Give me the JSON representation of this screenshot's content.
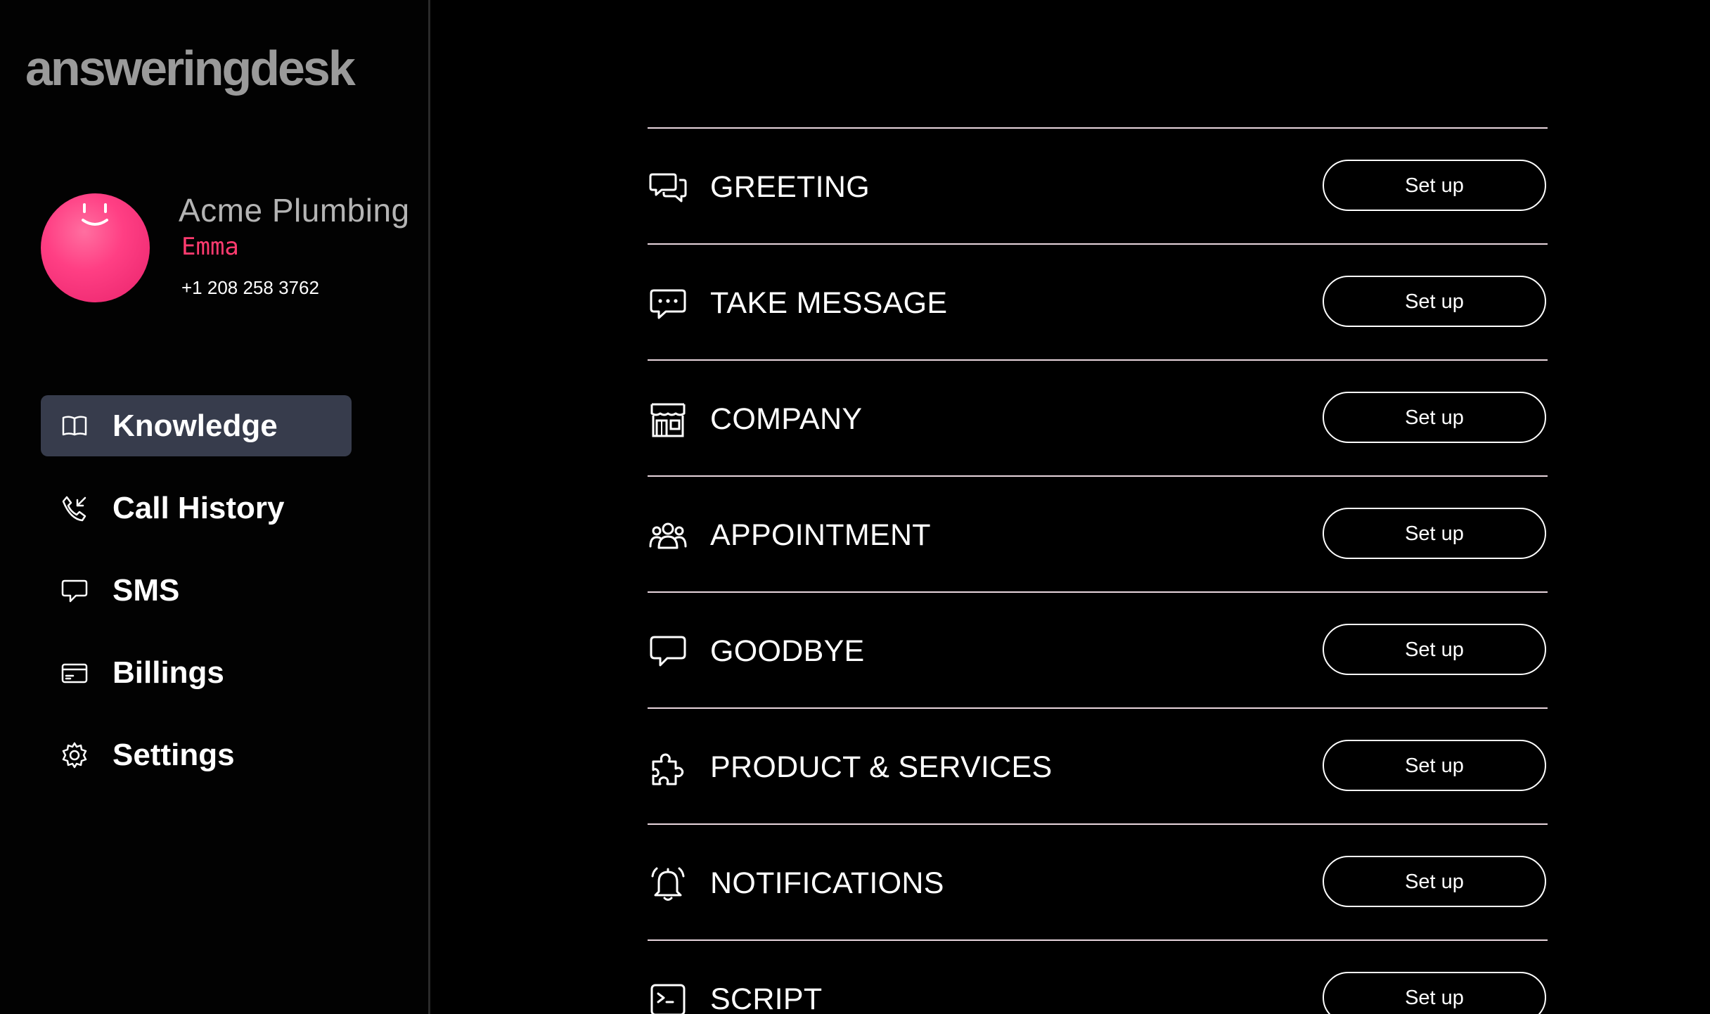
{
  "brand": {
    "logo_text": "answeringdesk"
  },
  "profile": {
    "company": "Acme Plumbing",
    "agent": "Emma",
    "phone": "+1 208 258 3762"
  },
  "sidebar": {
    "items": [
      {
        "label": "Knowledge",
        "icon": "book-icon",
        "active": true
      },
      {
        "label": "Call History",
        "icon": "phone-incoming-icon",
        "active": false
      },
      {
        "label": "SMS",
        "icon": "message-bubble-icon",
        "active": false
      },
      {
        "label": "Billings",
        "icon": "credit-card-icon",
        "active": false
      },
      {
        "label": "Settings",
        "icon": "gear-icon",
        "active": false
      }
    ]
  },
  "main": {
    "sections": [
      {
        "label": "GREETING",
        "icon": "chat-bubbles-icon",
        "button": "Set up"
      },
      {
        "label": "TAKE MESSAGE",
        "icon": "message-dots-icon",
        "button": "Set up"
      },
      {
        "label": "COMPANY",
        "icon": "storefront-icon",
        "button": "Set up"
      },
      {
        "label": "APPOINTMENT",
        "icon": "people-group-icon",
        "button": "Set up"
      },
      {
        "label": "GOODBYE",
        "icon": "speech-bubble-icon",
        "button": "Set up"
      },
      {
        "label": "PRODUCT & SERVICES",
        "icon": "puzzle-icon",
        "button": "Set up"
      },
      {
        "label": "NOTIFICATIONS",
        "icon": "bell-icon",
        "button": "Set up"
      },
      {
        "label": "SCRIPT",
        "icon": "terminal-icon",
        "button": "Set up"
      }
    ]
  },
  "colors": {
    "background": "#000000",
    "active_nav": "#373c4c",
    "accent_pink": "#ff3b6f",
    "divider": "#e9d6de",
    "logo_gray": "#9a9a9a"
  }
}
